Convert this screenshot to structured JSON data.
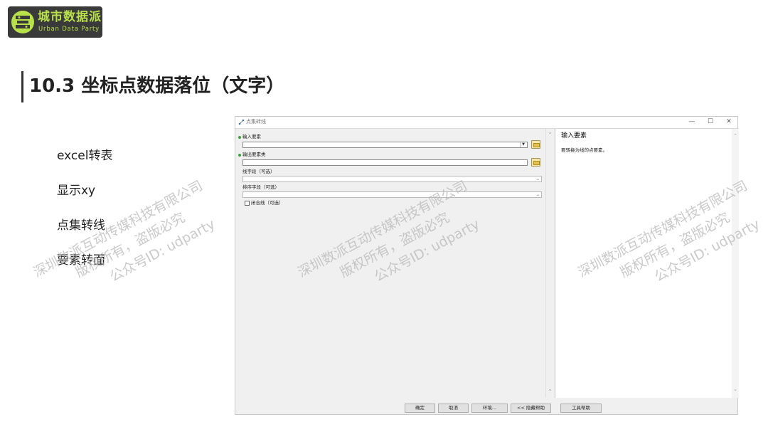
{
  "logo": {
    "name": "城市数据派",
    "subtitle": "Urban Data Party"
  },
  "heading": {
    "title": "10.3 坐标点数据落位（文字）"
  },
  "menu": {
    "items": [
      "excel转表",
      "显示xy",
      "点集转线",
      "要素转面"
    ]
  },
  "watermark": {
    "line1": "深圳数派互动传媒科技有限公司",
    "line2": "版权所有，盗版必究",
    "line3": "公众号ID: udparty"
  },
  "dialog": {
    "title": "点集转线",
    "window_controls": [
      "—",
      "☐",
      "✕"
    ],
    "fields": {
      "input_features": {
        "label": "输入要素",
        "value": ""
      },
      "output_features": {
        "label": "输出要素类",
        "value": ""
      },
      "line_field": {
        "label": "线字段（可选）",
        "value": ""
      },
      "sort_field": {
        "label": "排序字段（可选）",
        "value": ""
      },
      "close_line": {
        "label": "闭合线（可选）",
        "checked": false
      }
    },
    "help": {
      "title": "输入要素",
      "text": "要转换为线的点要素。"
    },
    "buttons": {
      "ok": "确定",
      "cancel": "取消",
      "environments": "环境...",
      "hide_help": "<< 隐藏帮助",
      "tool_help": "工具帮助"
    }
  },
  "colors": {
    "logo_bg": "#3a3a3a",
    "logo_accent": "#b9e14a",
    "required_marker": "#3aa43a"
  }
}
